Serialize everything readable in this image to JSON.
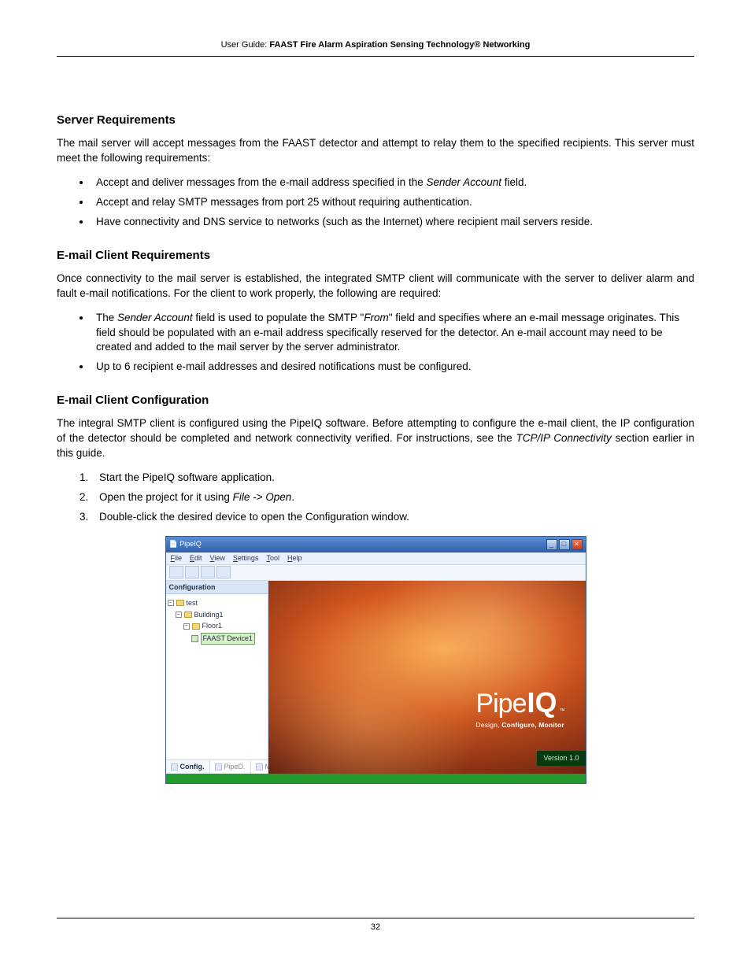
{
  "header": {
    "prefix": "User Guide: ",
    "title": "FAAST Fire Alarm Aspiration Sensing Technology® Networking"
  },
  "sections": {
    "server": {
      "heading": "Server Requirements",
      "intro": "The mail server will accept messages from the FAAST detector and attempt to relay them to the specified recipients. This server must meet the following requirements:",
      "bullets": [
        {
          "pre": "Accept and deliver messages from the e-mail address specified in the ",
          "it": "Sender Account",
          "post": " field."
        },
        {
          "pre": "Accept and relay SMTP messages from port 25 without requiring authentication.",
          "it": "",
          "post": ""
        },
        {
          "pre": "Have connectivity and DNS service to networks (such as the Internet) where recipient mail servers reside.",
          "it": "",
          "post": ""
        }
      ]
    },
    "clientReq": {
      "heading": "E-mail Client Requirements",
      "intro": "Once connectivity to the mail server is established, the integrated SMTP client will communicate with the server to deliver alarm and fault e-mail notifications. For the client to work properly, the following are required:",
      "bullets": [
        {
          "pre": "The ",
          "it1": "Sender Account",
          "mid": " field is used to populate the SMTP \"",
          "it2": "From",
          "post": "\" field and specifies where an e-mail message originates. This field should be populated with an e-mail address specifically reserved for the detector. An e-mail account may need to be created and added to the mail server by the server administrator."
        },
        {
          "plain": "Up to 6 recipient e-mail addresses and desired notifications must be configured."
        }
      ]
    },
    "clientCfg": {
      "heading": "E-mail Client Configuration",
      "intro_pre": "The integral SMTP client is configured using the PipeIQ software. Before attempting to configure the e-mail client, the IP configuration of the detector should be completed and network connectivity verified. For instructions, see the ",
      "intro_it": "TCP/IP Connectivity",
      "intro_post": " section earlier in this guide.",
      "steps": [
        "Start the PipeIQ software application.",
        {
          "pre": "Open the project for it using ",
          "it": "File -> Open",
          "post": "."
        },
        "Double-click the desired device to open the Configuration window."
      ]
    }
  },
  "app": {
    "title": "PipeIQ",
    "menus": [
      "File",
      "Edit",
      "View",
      "Settings",
      "Tool",
      "Help"
    ],
    "sidebarHeader": "Configuration",
    "tree": {
      "root": "test",
      "building": "Building1",
      "floor": "Floor1",
      "device": "FAAST Device1"
    },
    "tabs": [
      "Config.",
      "PipeD.",
      "Monito."
    ],
    "brand": {
      "p": "Pipe",
      "iq": "IQ",
      "tm": "™",
      "tagline_pre": "Design, ",
      "tagline_b1": "Configure,",
      "tagline_sp": " ",
      "tagline_b2": "Monitor"
    },
    "version": "Version 1.0"
  },
  "pageNumber": "32"
}
